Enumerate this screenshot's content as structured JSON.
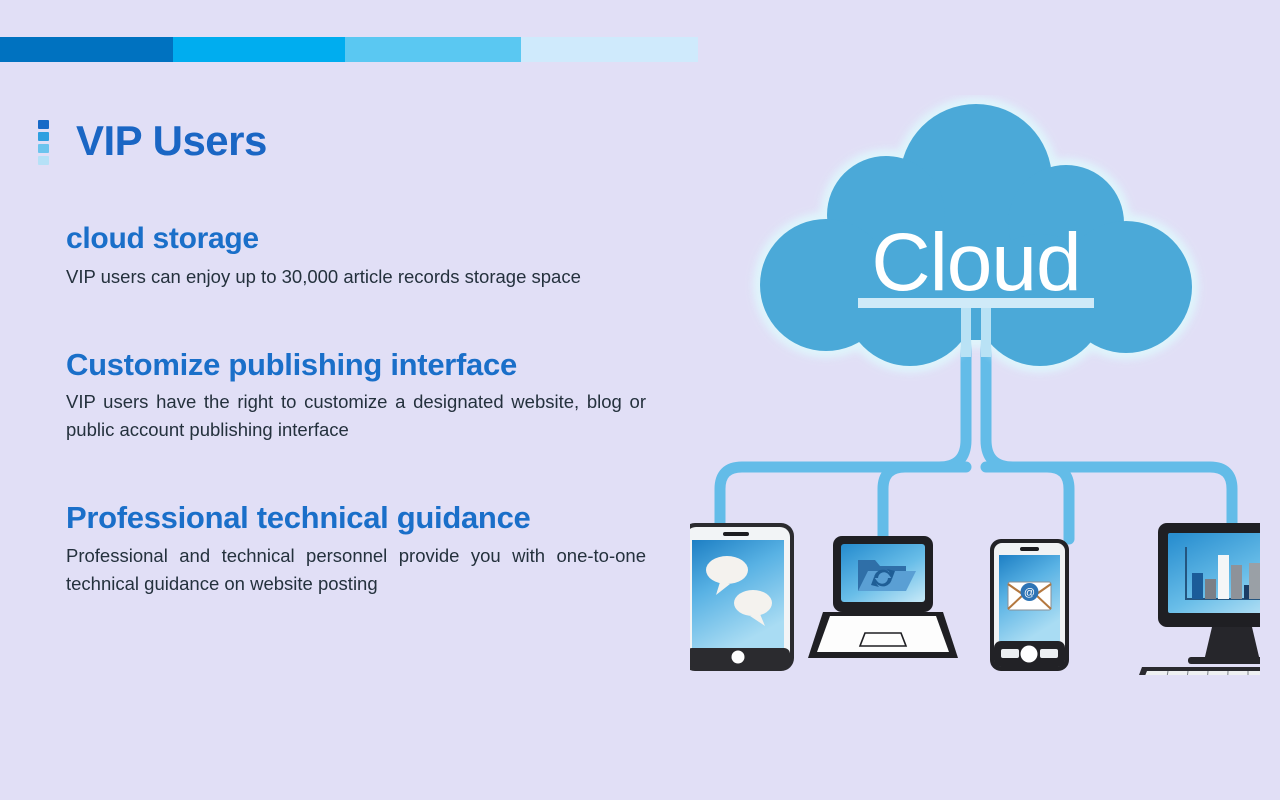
{
  "topbar": {
    "segments": [
      {
        "name": "segment-1",
        "color": "#0072c0"
      },
      {
        "name": "segment-2",
        "color": "#00adef"
      },
      {
        "name": "segment-3",
        "color": "#5ac8f2"
      },
      {
        "name": "segment-4",
        "color": "#cfeafc"
      }
    ]
  },
  "header": {
    "title": "VIP Users",
    "title_color": "#1a66c4"
  },
  "features": [
    {
      "heading": "cloud storage",
      "body": "VIP users can enjoy up to 30,000 article records storage space"
    },
    {
      "heading": "Customize publishing interface",
      "body": "VIP users have the right to customize a designated website, blog or public account publishing interface"
    },
    {
      "heading": "Professional technical guidance",
      "body": "Professional and technical personnel provide you with one-to-one technical guidance on website posting"
    }
  ],
  "graphic": {
    "cloud_label": "Cloud",
    "cloud_color": "#4ba9d8",
    "cloud_glow_color": "#d7f4fb",
    "connector_color": "#63bce8",
    "devices": [
      {
        "name": "tablet",
        "icon": "speech-bubbles-icon",
        "screen_label": ""
      },
      {
        "name": "laptop",
        "icon": "folder-sync-icon",
        "screen_label": ""
      },
      {
        "name": "smartphone",
        "icon": "email-envelope-icon",
        "screen_label": ""
      },
      {
        "name": "desktop-monitor",
        "icon": "bar-chart-icon",
        "screen_label": ""
      }
    ]
  },
  "colors": {
    "background": "#e1dff6",
    "accent_blue": "#1a6fc9",
    "body_text": "#24313d"
  }
}
